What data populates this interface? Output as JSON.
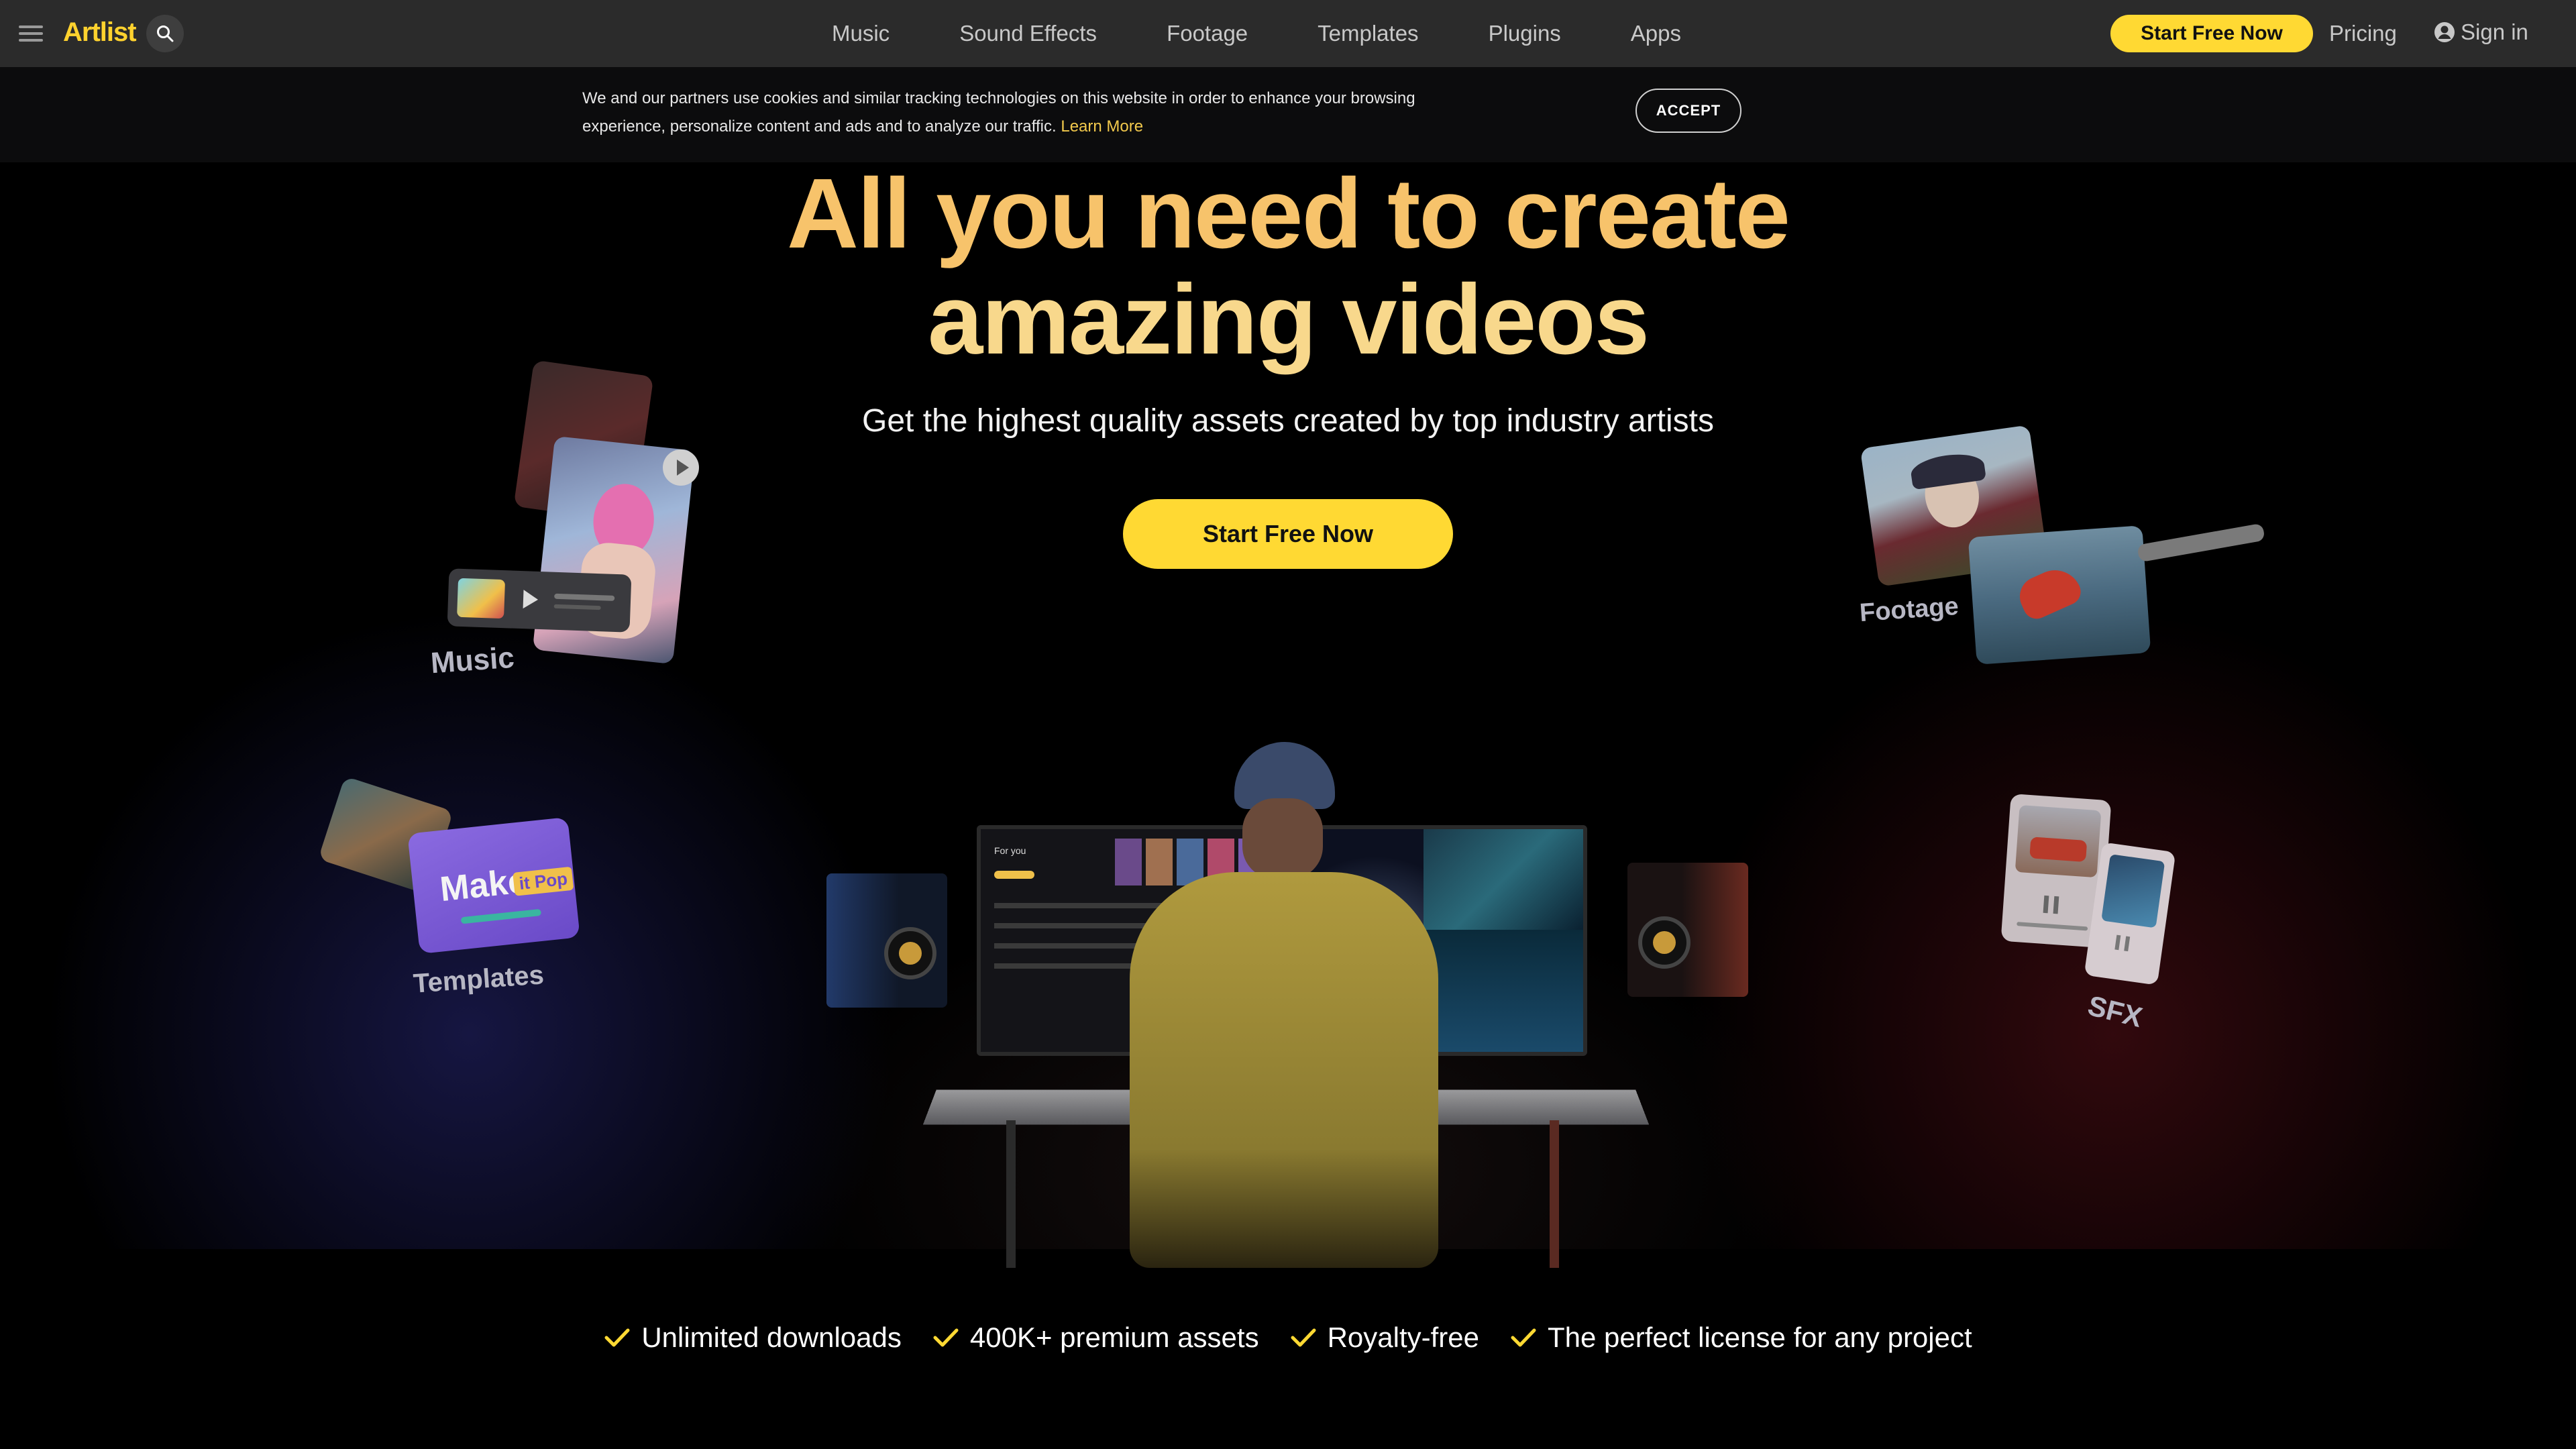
{
  "nav": {
    "logo": "Artlist",
    "links": [
      "Music",
      "Sound Effects",
      "Footage",
      "Templates",
      "Plugins",
      "Apps"
    ],
    "cta": "Start Free Now",
    "pricing": "Pricing",
    "signin": "Sign in",
    "icons": {
      "menu": "hamburger-icon",
      "search": "search-icon",
      "user": "user-icon"
    }
  },
  "cookie": {
    "text": "We and our partners use cookies and similar tracking technologies on this website in order to enhance your browsing experience, personalize content and ads and to analyze our traffic.",
    "link": "Learn More",
    "accept": "ACCEPT"
  },
  "hero": {
    "title_line1": "All you need to create",
    "title_line2": "amazing videos",
    "subtitle": "Get the highest quality assets created by top industry artists",
    "cta": "Start Free Now"
  },
  "categories": {
    "music": "Music",
    "footage": "Footage",
    "templates": "Templates",
    "sfx": "SFX",
    "template_card_text": "Make",
    "template_card_badge": "it Pop",
    "screen_heading": "For you"
  },
  "features": [
    "Unlimited downloads",
    "400K+ premium assets",
    "Royalty-free",
    "The perfect license for any project"
  ],
  "colors": {
    "accent": "#ffd933",
    "headline_top": "#f7c36b",
    "headline_bottom": "#f8d88c",
    "nav_bg": "#2b2b2b"
  }
}
